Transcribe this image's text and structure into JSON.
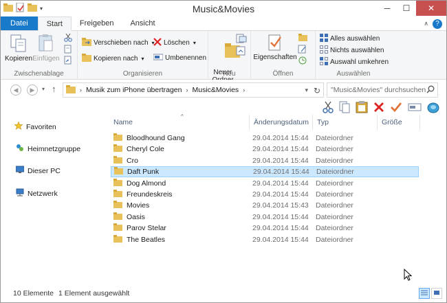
{
  "window": {
    "title": "Music&Movies",
    "controls": {
      "minimize": "─",
      "maximize": "☐",
      "close": "✕"
    }
  },
  "tabs": [
    {
      "label": "Datei",
      "kind": "file"
    },
    {
      "label": "Start",
      "kind": "active"
    },
    {
      "label": "Freigeben",
      "kind": "normal"
    },
    {
      "label": "Ansicht",
      "kind": "normal"
    }
  ],
  "ribbon": {
    "clipboard": {
      "label": "Zwischenablage",
      "copy": "Kopieren",
      "paste": "Einfügen"
    },
    "organize": {
      "label": "Organisieren",
      "move_to": "Verschieben nach",
      "copy_to": "Kopieren nach",
      "delete": "Löschen",
      "rename": "Umbenennen"
    },
    "new": {
      "label": "Neu",
      "new_folder": "Neuer\nOrdner"
    },
    "open": {
      "label": "Öffnen",
      "properties": "Eigenschaften"
    },
    "select": {
      "label": "Auswählen",
      "select_all": "Alles auswählen",
      "select_none": "Nichts auswählen",
      "invert": "Auswahl umkehren"
    }
  },
  "address": {
    "segments": [
      "Musik zum iPhone übertragen",
      "Music&Movies"
    ],
    "search_placeholder": "\"Music&Movies\" durchsuchen"
  },
  "nav_pane": [
    {
      "label": "Favoriten",
      "icon": "star-icon"
    },
    {
      "label": "Heimnetzgruppe",
      "icon": "homegroup-icon"
    },
    {
      "label": "Dieser PC",
      "icon": "computer-icon"
    },
    {
      "label": "Netzwerk",
      "icon": "network-icon"
    }
  ],
  "columns": {
    "name": "Name",
    "date": "Änderungsdatum",
    "type": "Typ",
    "size": "Größe"
  },
  "files": [
    {
      "name": "Bloodhound Gang",
      "date": "29.04.2014 15:44",
      "type": "Dateiordner",
      "selected": false
    },
    {
      "name": "Cheryl Cole",
      "date": "29.04.2014 15:44",
      "type": "Dateiordner",
      "selected": false
    },
    {
      "name": "Cro",
      "date": "29.04.2014 15:44",
      "type": "Dateiordner",
      "selected": false
    },
    {
      "name": "Daft Punk",
      "date": "29.04.2014 15:44",
      "type": "Dateiordner",
      "selected": true
    },
    {
      "name": "Dog Almond",
      "date": "29.04.2014 15:44",
      "type": "Dateiordner",
      "selected": false
    },
    {
      "name": "Freundeskreis",
      "date": "29.04.2014 15:44",
      "type": "Dateiordner",
      "selected": false
    },
    {
      "name": "Movies",
      "date": "29.04.2014 15:43",
      "type": "Dateiordner",
      "selected": false
    },
    {
      "name": "Oasis",
      "date": "29.04.2014 15:44",
      "type": "Dateiordner",
      "selected": false
    },
    {
      "name": "Parov Stelar",
      "date": "29.04.2014 15:44",
      "type": "Dateiordner",
      "selected": false
    },
    {
      "name": "The Beatles",
      "date": "29.04.2014 15:44",
      "type": "Dateiordner",
      "selected": false
    }
  ],
  "status": {
    "count": "10 Elemente",
    "selection": "1 Element ausgewählt"
  },
  "colors": {
    "accent": "#1979ca",
    "selection_bg": "#cce8ff",
    "selection_border": "#99d1ff",
    "folder": "#e8c15a"
  }
}
